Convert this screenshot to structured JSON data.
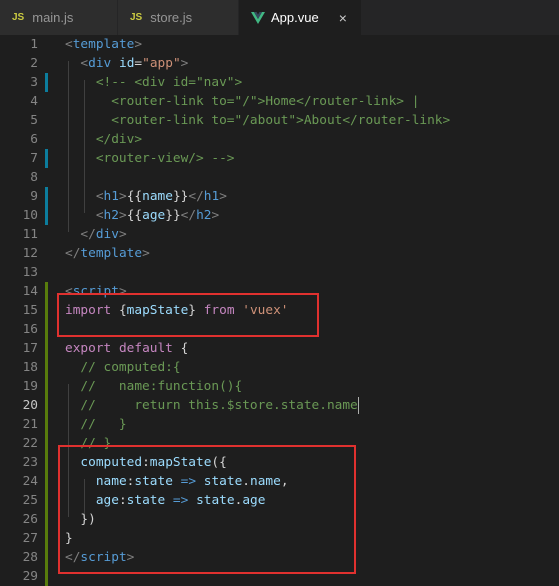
{
  "tabs": [
    {
      "icon": "JS",
      "label": "main.js",
      "active": false
    },
    {
      "icon": "JS",
      "label": "store.js",
      "active": false
    },
    {
      "icon": "vue-icon",
      "label": "App.vue",
      "active": true
    }
  ],
  "close_glyph": "×",
  "active_line": 20,
  "colors": {
    "background": "#1e1e1e",
    "modified_gutter": "#0c7d9d",
    "added_gutter": "#587c0c",
    "highlight_box": "#e0312f"
  },
  "lines": [
    {
      "n": "1",
      "tokens": [
        [
          "p",
          "<"
        ],
        [
          "t",
          "template"
        ],
        [
          "p",
          ">"
        ]
      ]
    },
    {
      "n": "2",
      "tokens": [
        [
          "w",
          "  "
        ],
        [
          "p",
          "<"
        ],
        [
          "t",
          "div"
        ],
        [
          "w",
          " "
        ],
        [
          "a",
          "id"
        ],
        [
          "w",
          "="
        ],
        [
          "s",
          "\"app\""
        ],
        [
          "p",
          ">"
        ]
      ]
    },
    {
      "n": "3",
      "tokens": [
        [
          "c",
          "    <!-- <div id=\"nav\">"
        ]
      ]
    },
    {
      "n": "4",
      "tokens": [
        [
          "c",
          "      <router-link to=\"/\">Home</router-link> |"
        ]
      ]
    },
    {
      "n": "5",
      "tokens": [
        [
          "c",
          "      <router-link to=\"/about\">About</router-link>"
        ]
      ]
    },
    {
      "n": "6",
      "tokens": [
        [
          "c",
          "    </div>"
        ]
      ]
    },
    {
      "n": "7",
      "tokens": [
        [
          "c",
          "    <router-view/> -->"
        ]
      ]
    },
    {
      "n": "8",
      "tokens": []
    },
    {
      "n": "9",
      "tokens": [
        [
          "w",
          "    "
        ],
        [
          "p",
          "<"
        ],
        [
          "t",
          "h1"
        ],
        [
          "p",
          ">"
        ],
        [
          "w",
          "{{"
        ],
        [
          "a",
          "name"
        ],
        [
          "w",
          "}}"
        ],
        [
          "p",
          "</"
        ],
        [
          "t",
          "h1"
        ],
        [
          "p",
          ">"
        ]
      ]
    },
    {
      "n": "10",
      "tokens": [
        [
          "w",
          "    "
        ],
        [
          "p",
          "<"
        ],
        [
          "t",
          "h2"
        ],
        [
          "p",
          ">"
        ],
        [
          "w",
          "{{"
        ],
        [
          "a",
          "age"
        ],
        [
          "w",
          "}}"
        ],
        [
          "p",
          "</"
        ],
        [
          "t",
          "h2"
        ],
        [
          "p",
          ">"
        ]
      ]
    },
    {
      "n": "11",
      "tokens": [
        [
          "w",
          "  "
        ],
        [
          "p",
          "</"
        ],
        [
          "t",
          "div"
        ],
        [
          "p",
          ">"
        ]
      ]
    },
    {
      "n": "12",
      "tokens": [
        [
          "p",
          "</"
        ],
        [
          "t",
          "template"
        ],
        [
          "p",
          ">"
        ]
      ]
    },
    {
      "n": "13",
      "tokens": []
    },
    {
      "n": "14",
      "tokens": [
        [
          "p",
          "<"
        ],
        [
          "t",
          "script"
        ],
        [
          "p",
          ">"
        ]
      ]
    },
    {
      "n": "15",
      "tokens": [
        [
          "k",
          "import"
        ],
        [
          "w",
          " {"
        ],
        [
          "a",
          "mapState"
        ],
        [
          "w",
          "} "
        ],
        [
          "k",
          "from"
        ],
        [
          "w",
          " "
        ],
        [
          "s",
          "'vuex'"
        ]
      ]
    },
    {
      "n": "16",
      "tokens": []
    },
    {
      "n": "17",
      "tokens": [
        [
          "k",
          "export"
        ],
        [
          "w",
          " "
        ],
        [
          "k",
          "default"
        ],
        [
          "w",
          " {"
        ]
      ]
    },
    {
      "n": "18",
      "tokens": [
        [
          "c",
          "  // computed:{"
        ]
      ]
    },
    {
      "n": "19",
      "tokens": [
        [
          "c",
          "  //   name:function(){"
        ]
      ]
    },
    {
      "n": "20",
      "tokens": [
        [
          "c",
          "  //     return this.$store.state.name"
        ]
      ]
    },
    {
      "n": "21",
      "tokens": [
        [
          "c",
          "  //   }"
        ]
      ]
    },
    {
      "n": "22",
      "tokens": [
        [
          "c",
          "  // }"
        ]
      ]
    },
    {
      "n": "23",
      "tokens": [
        [
          "w",
          "  "
        ],
        [
          "a",
          "computed"
        ],
        [
          "w",
          ":"
        ],
        [
          "a",
          "mapState"
        ],
        [
          "w",
          "({"
        ]
      ]
    },
    {
      "n": "24",
      "tokens": [
        [
          "w",
          "    "
        ],
        [
          "a",
          "name"
        ],
        [
          "w",
          ":"
        ],
        [
          "a",
          "state"
        ],
        [
          "w",
          " "
        ],
        [
          "b",
          "=>"
        ],
        [
          "w",
          " "
        ],
        [
          "a",
          "state"
        ],
        [
          "w",
          "."
        ],
        [
          "a",
          "name"
        ],
        [
          "w",
          ","
        ]
      ]
    },
    {
      "n": "25",
      "tokens": [
        [
          "w",
          "    "
        ],
        [
          "a",
          "age"
        ],
        [
          "w",
          ":"
        ],
        [
          "a",
          "state"
        ],
        [
          "w",
          " "
        ],
        [
          "b",
          "=>"
        ],
        [
          "w",
          " "
        ],
        [
          "a",
          "state"
        ],
        [
          "w",
          "."
        ],
        [
          "a",
          "age"
        ]
      ]
    },
    {
      "n": "26",
      "tokens": [
        [
          "w",
          "  })"
        ]
      ]
    },
    {
      "n": "27",
      "tokens": [
        [
          "w",
          "}"
        ]
      ]
    },
    {
      "n": "28",
      "tokens": [
        [
          "p",
          "</"
        ],
        [
          "t",
          "script"
        ],
        [
          "p",
          ">"
        ]
      ]
    },
    {
      "n": "29",
      "tokens": []
    }
  ]
}
